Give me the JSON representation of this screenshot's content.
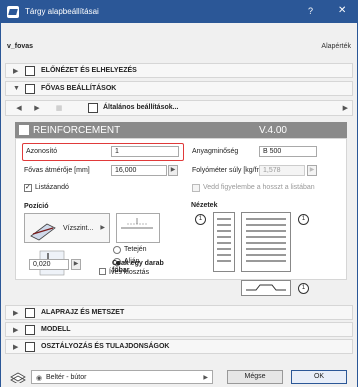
{
  "window": {
    "title": "Tárgy alapbeállításai",
    "help": "?",
    "close": "✕"
  },
  "top": {
    "object_name": "v_fovas",
    "default_label": "Alapérték"
  },
  "sections": {
    "preview": "ELŐNÉZET ÉS ELHELYEZÉS",
    "params": "FŐVAS BEÁLLÍTÁSOK",
    "floorplan": "ALAPRAJZ ÉS METSZET",
    "model": "MODELL",
    "classification": "OSZTÁLYOZÁS ÉS TULAJDONSÁGOK"
  },
  "nav": {
    "page": "Általános beállítások..."
  },
  "banner": {
    "title": "REINFORCEMENT",
    "version": "V.4.00"
  },
  "form": {
    "id_label": "Azonosító",
    "id_value": "1",
    "material_label": "Anyagminőség",
    "material_value": "B 500",
    "diameter_label": "Fővas átmérője [mm]",
    "diameter_value": "16,000",
    "weight_label": "Folyóméter súly [kg/fm]",
    "weight_value": "1,578",
    "listable_label": "Listázandó",
    "listable_checked": true,
    "consider_label": "Vedd figyelembe a hosszt a listában",
    "consider_checked": false
  },
  "position": {
    "title": "Pozíció",
    "orient_label": "Vízszint...",
    "top_label": "Tetején",
    "bottom_label": "Alján",
    "bottom_selected": true,
    "single_label": "Csak egy darab főbar",
    "strong_label": "Íves kiosztás",
    "offset_value": "0,020"
  },
  "views": {
    "title": "Nézetek",
    "num_left": "1",
    "num_right": "1",
    "num_bottom": "1"
  },
  "footer": {
    "layer": "Beltér - bútor",
    "cancel": "Mégse",
    "ok": "OK"
  },
  "colors": {
    "titlebar": "#2b5797",
    "highlight": "#e03a3a",
    "banner": "#8a8a8a"
  }
}
